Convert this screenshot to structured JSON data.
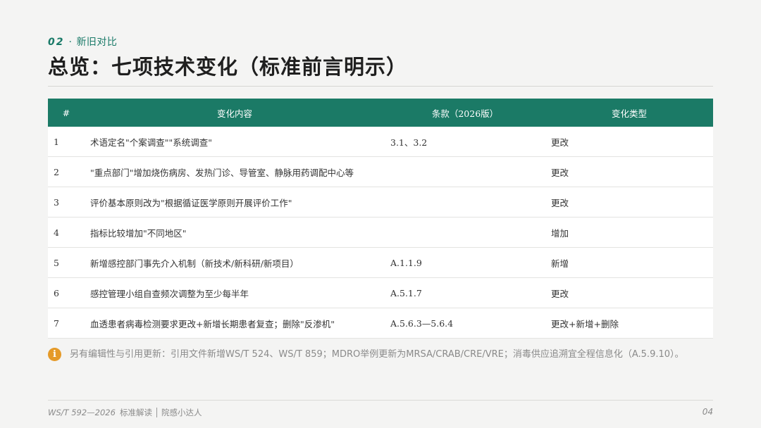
{
  "header": {
    "section_number": "02",
    "section_dot": "·",
    "section_title": "新旧对比",
    "title": "总览：七项技术变化（标准前言明示）"
  },
  "table": {
    "headers": [
      "#",
      "变化内容",
      "条款（2026版）",
      "变化类型"
    ],
    "rows": [
      {
        "num": "1",
        "content": "术语定名\"个案调查\"\"系统调查\"",
        "clause": "3.1、3.2",
        "type": "更改"
      },
      {
        "num": "2",
        "content": "\"重点部门\"增加烧伤病房、发热门诊、导管室、静脉用药调配中心等",
        "clause": "",
        "type": "更改"
      },
      {
        "num": "3",
        "content": "评价基本原则改为\"根据循证医学原则开展评价工作\"",
        "clause": "",
        "type": "更改"
      },
      {
        "num": "4",
        "content": "指标比较增加\"不同地区\"",
        "clause": "",
        "type": "增加"
      },
      {
        "num": "5",
        "content": "新增感控部门事先介入机制（新技术/新科研/新项目）",
        "clause": "A.1.1.9",
        "type": "新增"
      },
      {
        "num": "6",
        "content": "感控管理小组自查频次调整为至少每半年",
        "clause": "A.5.1.7",
        "type": "更改"
      },
      {
        "num": "7",
        "content": "血透患者病毒检测要求更改+新增长期患者复查；删除\"反渗机\"",
        "clause": "A.5.6.3—5.6.4",
        "type": "更改+新增+删除"
      }
    ]
  },
  "note": {
    "icon": "info-icon",
    "icon_glyph": "i",
    "text": "另有编辑性与引用更新：引用文件新增WS/T 524、WS/T 859；MDRO举例更新为MRSA/CRAB/CRE/VRE；消毒供应追溯宜全程信息化（A.5.9.10）。"
  },
  "footer": {
    "doc": "WS/T 592—2026",
    "label": "标准解读",
    "author": "院感小达人",
    "page": "04"
  },
  "colors": {
    "accent": "#1b7a66",
    "info": "#e59a28",
    "background": "#f4f4f3"
  }
}
